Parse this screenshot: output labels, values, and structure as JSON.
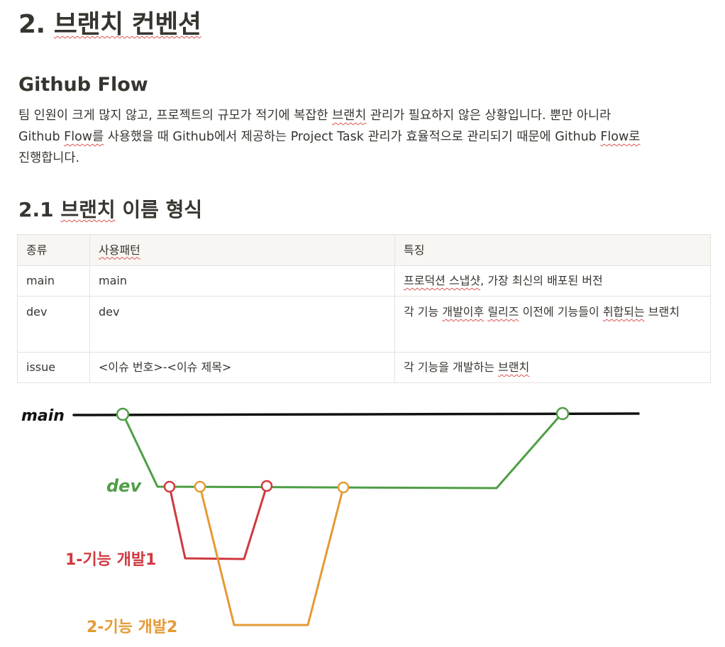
{
  "heading": {
    "number": "2.",
    "text": "브랜치 컨벤션"
  },
  "section": {
    "title": "Github Flow"
  },
  "paragraph": {
    "p1": "팀 인원이 크게 많지 않고, 프로젝트의 규모가 적기에 복잡한 ",
    "p2": "브랜치",
    "p3": " 관리가 필요하지 않은 상황입니다. 뿐만 아니라 Github ",
    "p4": "Flow를",
    "p5": " 사용했을 때 Github에서 제공하는 Project Task 관리가 효율적으로 관리되기 때문에 Github ",
    "p6": "Flow로",
    "p7": " 진행합니다."
  },
  "subsection": {
    "number": "2.1",
    "text_a": "브랜치",
    "text_b": " 이름 형식"
  },
  "table": {
    "headers": [
      "종류",
      "사용패턴",
      "특징"
    ],
    "rows": [
      {
        "type": "main",
        "pattern": "main",
        "desc_a": "프로덕션 스냅샷",
        "desc_b": ", 가장 최신의 배포된 버전"
      },
      {
        "type": "dev",
        "pattern": "dev",
        "desc_a": "각 기능 ",
        "desc_b": "개발이후",
        "desc_c": " ",
        "desc_d": "릴리즈",
        "desc_e": " 이전에 기능들이 ",
        "desc_f": "취합되는",
        "desc_g": " 브랜치"
      },
      {
        "type": "issue",
        "pattern": "<이슈 번호>-<이슈 제목>",
        "desc_a": "각 기능을 개발하는 ",
        "desc_b": "브랜치"
      }
    ]
  },
  "diagram": {
    "labels": {
      "main": "main",
      "dev": "dev",
      "feature1": "1-기능  개발1",
      "feature2": "2-기능  개발2"
    },
    "colors": {
      "main": "#111111",
      "dev": "#4e9e45",
      "feature1": "#cf3a3f",
      "feature2": "#e59a34"
    }
  }
}
